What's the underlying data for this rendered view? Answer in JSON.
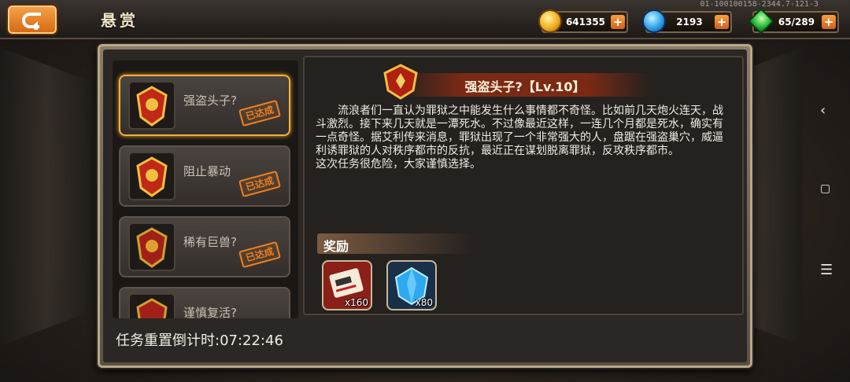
{
  "header": {
    "title": "悬赏",
    "version": "01-100100158-2344.7-121-3"
  },
  "resources": [
    {
      "name": "gold",
      "icon": "coin-icon",
      "value": "641355"
    },
    {
      "name": "crystal",
      "icon": "crystal-icon",
      "value": "2193"
    },
    {
      "name": "energy",
      "icon": "energy-icon",
      "value": "65/289"
    }
  ],
  "quests": [
    {
      "name": "强盗头子?",
      "status": "已达成",
      "selected": true
    },
    {
      "name": "阻止暴动",
      "status": "已达成",
      "selected": false
    },
    {
      "name": "稀有巨兽?",
      "status": "已达成",
      "selected": false
    },
    {
      "name": "谨慎复活?",
      "status": "",
      "selected": false
    }
  ],
  "detail": {
    "title": "强盗头子?【Lv.10】",
    "description": "流浪者们一直认为罪狱之中能发生什么事情都不奇怪。比如前几天炮火连天，战斗激烈。接下来几天就是一潭死水。不过像最近这样，一连几个月都是死水，确实有一点奇怪。据艾利传来消息，罪狱出现了一个非常强大的人，盘踞在强盗巢穴，威逼利诱罪狱的人对秩序都市的反抗，最近正在谋划脱离罪狱，反攻秩序都市。",
    "description2": "这次任务很危险，大家谨慎选择。",
    "reward_label": "奖励",
    "rewards": [
      {
        "icon": "ticket-icon",
        "count": "x160"
      },
      {
        "icon": "crystal-gem-icon",
        "count": "x80"
      }
    ]
  },
  "footer": {
    "countdown": "任务重置倒计时:07:22:46"
  },
  "colors": {
    "accent": "#f08020",
    "selected_border": "#f0b040"
  }
}
